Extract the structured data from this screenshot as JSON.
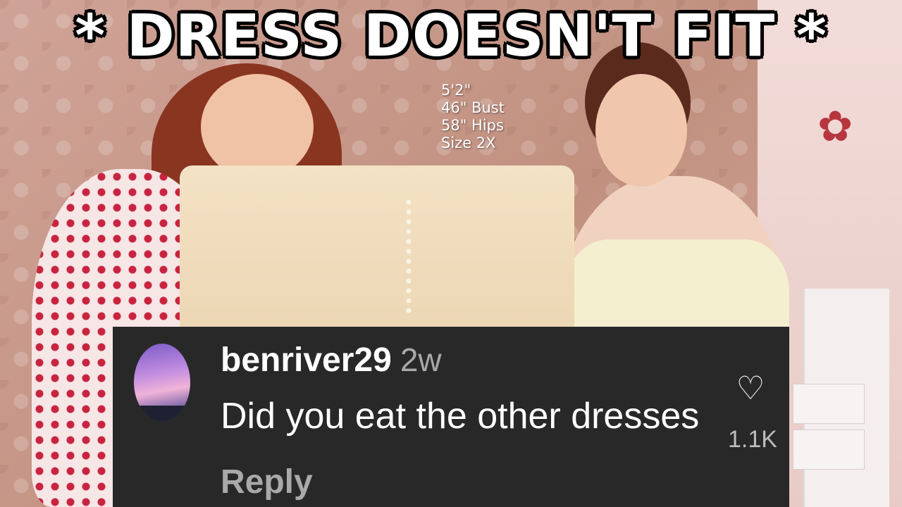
{
  "headline": "* DRESS DOESN'T FIT *",
  "stats": [
    "5'2\"",
    "46\" Bust",
    "58\" Hips",
    "Size 2X"
  ],
  "comment": {
    "username": "benriver29",
    "age": "2w",
    "text": "Did you eat the other dresses",
    "reply_label": "Reply",
    "like_count": "1.1K",
    "like_icon": "heart-outline-icon"
  },
  "colors": {
    "comment_bg": "#282828",
    "muted_text": "#a9a9a9",
    "headline_text": "#ffffff"
  }
}
